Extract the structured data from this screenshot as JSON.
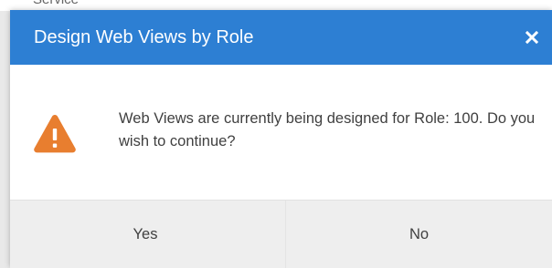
{
  "background": {
    "partial_text": "Service"
  },
  "dialog": {
    "title": "Design Web Views by Role",
    "close_icon": "close-icon",
    "message_icon": "warning-icon",
    "message": "Web Views are currently being designed for Role: 100. Do you wish to continue?",
    "buttons": {
      "yes_label": "Yes",
      "no_label": "No"
    }
  },
  "colors": {
    "header": "#2d7fd3",
    "warning": "#e87e2f",
    "footer": "#eeeeee"
  }
}
